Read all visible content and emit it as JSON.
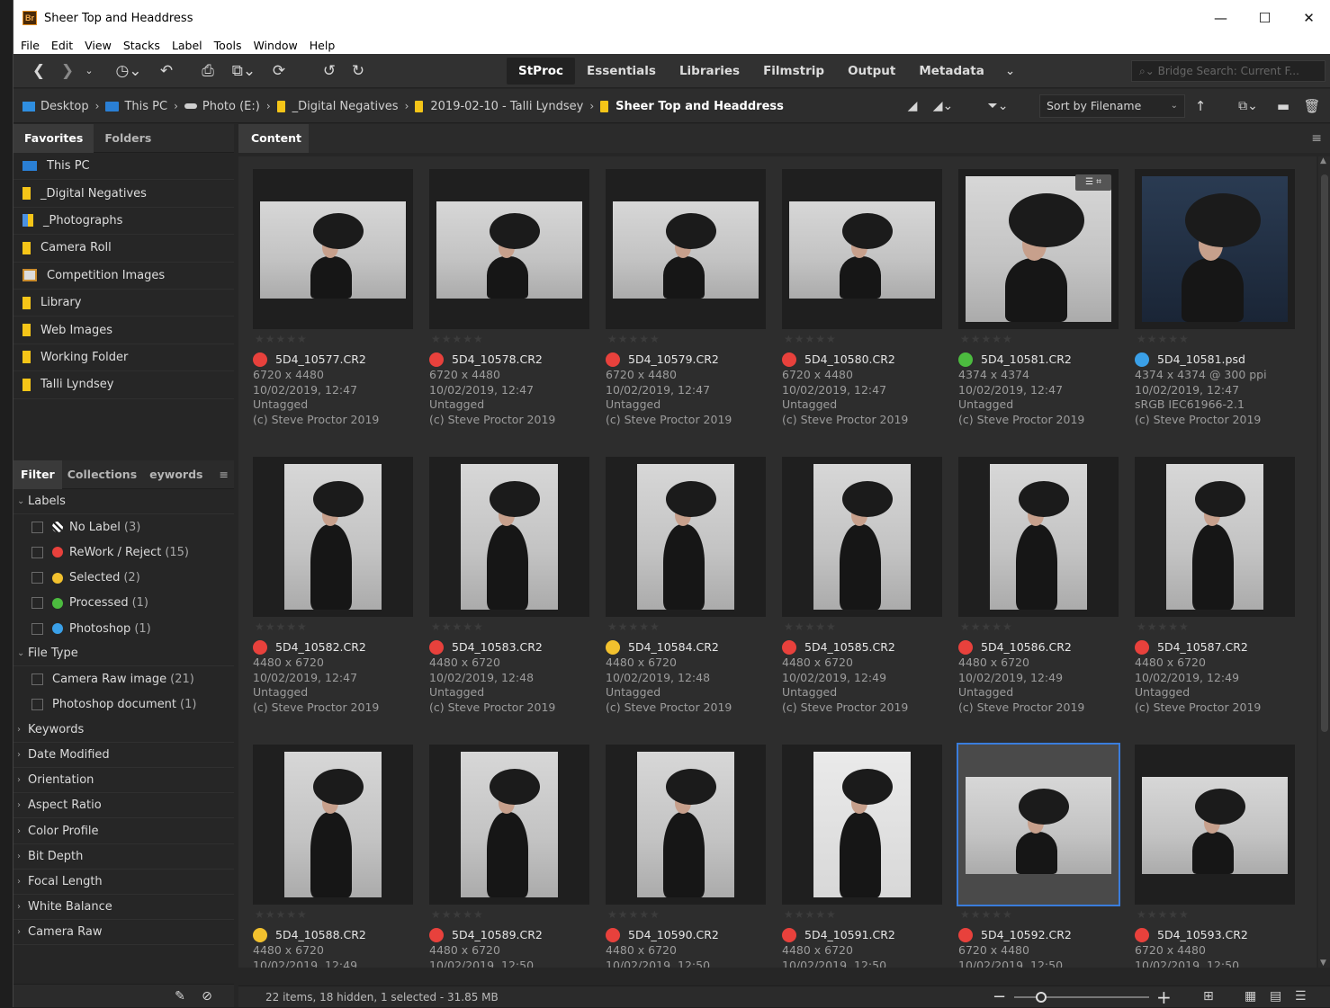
{
  "window": {
    "title": "Sheer Top and Headdress",
    "app_icon": "Br",
    "controls": [
      "—",
      "☐",
      "✕"
    ]
  },
  "menu": [
    "File",
    "Edit",
    "View",
    "Stacks",
    "Label",
    "Tools",
    "Window",
    "Help"
  ],
  "workspaces": [
    "StProc",
    "Essentials",
    "Libraries",
    "Filmstrip",
    "Output",
    "Metadata"
  ],
  "active_workspace": "StProc",
  "search": {
    "placeholder": "Bridge Search: Current F..."
  },
  "breadcrumb": [
    "Desktop",
    "This PC",
    "Photo (E:)",
    "_Digital Negatives",
    "2019-02-10 - Talli Lyndsey",
    "Sheer Top and Headdress"
  ],
  "sort": {
    "label": "Sort by Filename"
  },
  "panels": {
    "tabs": [
      "Favorites",
      "Folders"
    ],
    "filter_tabs": [
      "Filter",
      "Collections",
      "eywords"
    ]
  },
  "favorites": [
    {
      "label": "This PC",
      "icon": "pc-icon"
    },
    {
      "label": "_Digital Negatives",
      "icon": "folder-icon"
    },
    {
      "label": "_Photographs",
      "icon": "photos-folder-icon"
    },
    {
      "label": "Camera Roll",
      "icon": "folder-icon"
    },
    {
      "label": "Competition Images",
      "icon": "image-folder-icon"
    },
    {
      "label": "Library",
      "icon": "folder-icon"
    },
    {
      "label": "Web Images",
      "icon": "folder-icon"
    },
    {
      "label": "Working Folder",
      "icon": "folder-icon"
    },
    {
      "label": "Talli Lyndsey",
      "icon": "folder-icon"
    }
  ],
  "filter": {
    "labels_header": "Labels",
    "labels": [
      {
        "label": "No Label",
        "count": "(3)",
        "color": "none"
      },
      {
        "label": "ReWork / Reject",
        "count": "(15)",
        "color": "#e8413c"
      },
      {
        "label": "Selected",
        "count": "(2)",
        "color": "#f2c12e"
      },
      {
        "label": "Processed",
        "count": "(1)",
        "color": "#4cbb3f"
      },
      {
        "label": "Photoshop",
        "count": "(1)",
        "color": "#3aa0e8"
      }
    ],
    "filetype_header": "File Type",
    "filetypes": [
      {
        "label": "Camera Raw image",
        "count": "(21)"
      },
      {
        "label": "Photoshop document",
        "count": "(1)"
      }
    ],
    "collapsed": [
      "Keywords",
      "Date Modified",
      "Orientation",
      "Aspect Ratio",
      "Color Profile",
      "Bit Depth",
      "Focal Length",
      "White Balance",
      "Camera Raw"
    ]
  },
  "content": {
    "tab": "Content",
    "items": [
      {
        "name": "5D4_10577.CR2",
        "label_color": "#e8413c",
        "dims": "6720 x 4480",
        "date": "10/02/2019, 12:47",
        "tag": "Untagged",
        "copyright": "(c) Steve Proctor 2019",
        "orient": "land"
      },
      {
        "name": "5D4_10578.CR2",
        "label_color": "#e8413c",
        "dims": "6720 x 4480",
        "date": "10/02/2019, 12:47",
        "tag": "Untagged",
        "copyright": "(c) Steve Proctor 2019",
        "orient": "land"
      },
      {
        "name": "5D4_10579.CR2",
        "label_color": "#e8413c",
        "dims": "6720 x 4480",
        "date": "10/02/2019, 12:47",
        "tag": "Untagged",
        "copyright": "(c) Steve Proctor 2019",
        "orient": "land"
      },
      {
        "name": "5D4_10580.CR2",
        "label_color": "#e8413c",
        "dims": "6720 x 4480",
        "date": "10/02/2019, 12:47",
        "tag": "Untagged",
        "copyright": "(c) Steve Proctor 2019",
        "orient": "land"
      },
      {
        "name": "5D4_10581.CR2",
        "label_color": "#4cbb3f",
        "dims": "4374 x 4374",
        "date": "10/02/2019, 12:47",
        "tag": "Untagged",
        "copyright": "(c) Steve Proctor 2019",
        "orient": "square",
        "badge": "☰ ⌗"
      },
      {
        "name": "5D4_10581.psd",
        "label_color": "#3aa0e8",
        "dims": "4374 x 4374 @ 300 ppi",
        "date": "10/02/2019, 12:47",
        "tag": "sRGB IEC61966-2.1",
        "copyright": "(c) Steve Proctor 2019",
        "orient": "square-dark"
      },
      {
        "name": "5D4_10582.CR2",
        "label_color": "#e8413c",
        "dims": "4480 x 6720",
        "date": "10/02/2019, 12:47",
        "tag": "Untagged",
        "copyright": "(c) Steve Proctor 2019",
        "orient": "port"
      },
      {
        "name": "5D4_10583.CR2",
        "label_color": "#e8413c",
        "dims": "4480 x 6720",
        "date": "10/02/2019, 12:48",
        "tag": "Untagged",
        "copyright": "(c) Steve Proctor 2019",
        "orient": "port"
      },
      {
        "name": "5D4_10584.CR2",
        "label_color": "#f2c12e",
        "dims": "4480 x 6720",
        "date": "10/02/2019, 12:48",
        "tag": "Untagged",
        "copyright": "(c) Steve Proctor 2019",
        "orient": "port"
      },
      {
        "name": "5D4_10585.CR2",
        "label_color": "#e8413c",
        "dims": "4480 x 6720",
        "date": "10/02/2019, 12:49",
        "tag": "Untagged",
        "copyright": "(c) Steve Proctor 2019",
        "orient": "port"
      },
      {
        "name": "5D4_10586.CR2",
        "label_color": "#e8413c",
        "dims": "4480 x 6720",
        "date": "10/02/2019, 12:49",
        "tag": "Untagged",
        "copyright": "(c) Steve Proctor 2019",
        "orient": "port"
      },
      {
        "name": "5D4_10587.CR2",
        "label_color": "#e8413c",
        "dims": "4480 x 6720",
        "date": "10/02/2019, 12:49",
        "tag": "Untagged",
        "copyright": "(c) Steve Proctor 2019",
        "orient": "port"
      },
      {
        "name": "5D4_10588.CR2",
        "label_color": "#f2c12e",
        "dims": "4480 x 6720",
        "date": "10/02/2019, 12:49",
        "orient": "port"
      },
      {
        "name": "5D4_10589.CR2",
        "label_color": "#e8413c",
        "dims": "4480 x 6720",
        "date": "10/02/2019, 12:50",
        "orient": "port"
      },
      {
        "name": "5D4_10590.CR2",
        "label_color": "#e8413c",
        "dims": "4480 x 6720",
        "date": "10/02/2019, 12:50",
        "orient": "port"
      },
      {
        "name": "5D4_10591.CR2",
        "label_color": "#e8413c",
        "dims": "4480 x 6720",
        "date": "10/02/2019, 12:50",
        "orient": "port-studio"
      },
      {
        "name": "5D4_10592.CR2",
        "label_color": "#e8413c",
        "dims": "6720 x 4480",
        "date": "10/02/2019, 12:50",
        "orient": "land",
        "selected": true
      },
      {
        "name": "5D4_10593.CR2",
        "label_color": "#e8413c",
        "dims": "6720 x 4480",
        "date": "10/02/2019, 12:50",
        "orient": "land"
      }
    ]
  },
  "status": {
    "text": "22 items, 18 hidden, 1 selected - 31.85 MB",
    "thumbnail_zoom": 0.2
  }
}
